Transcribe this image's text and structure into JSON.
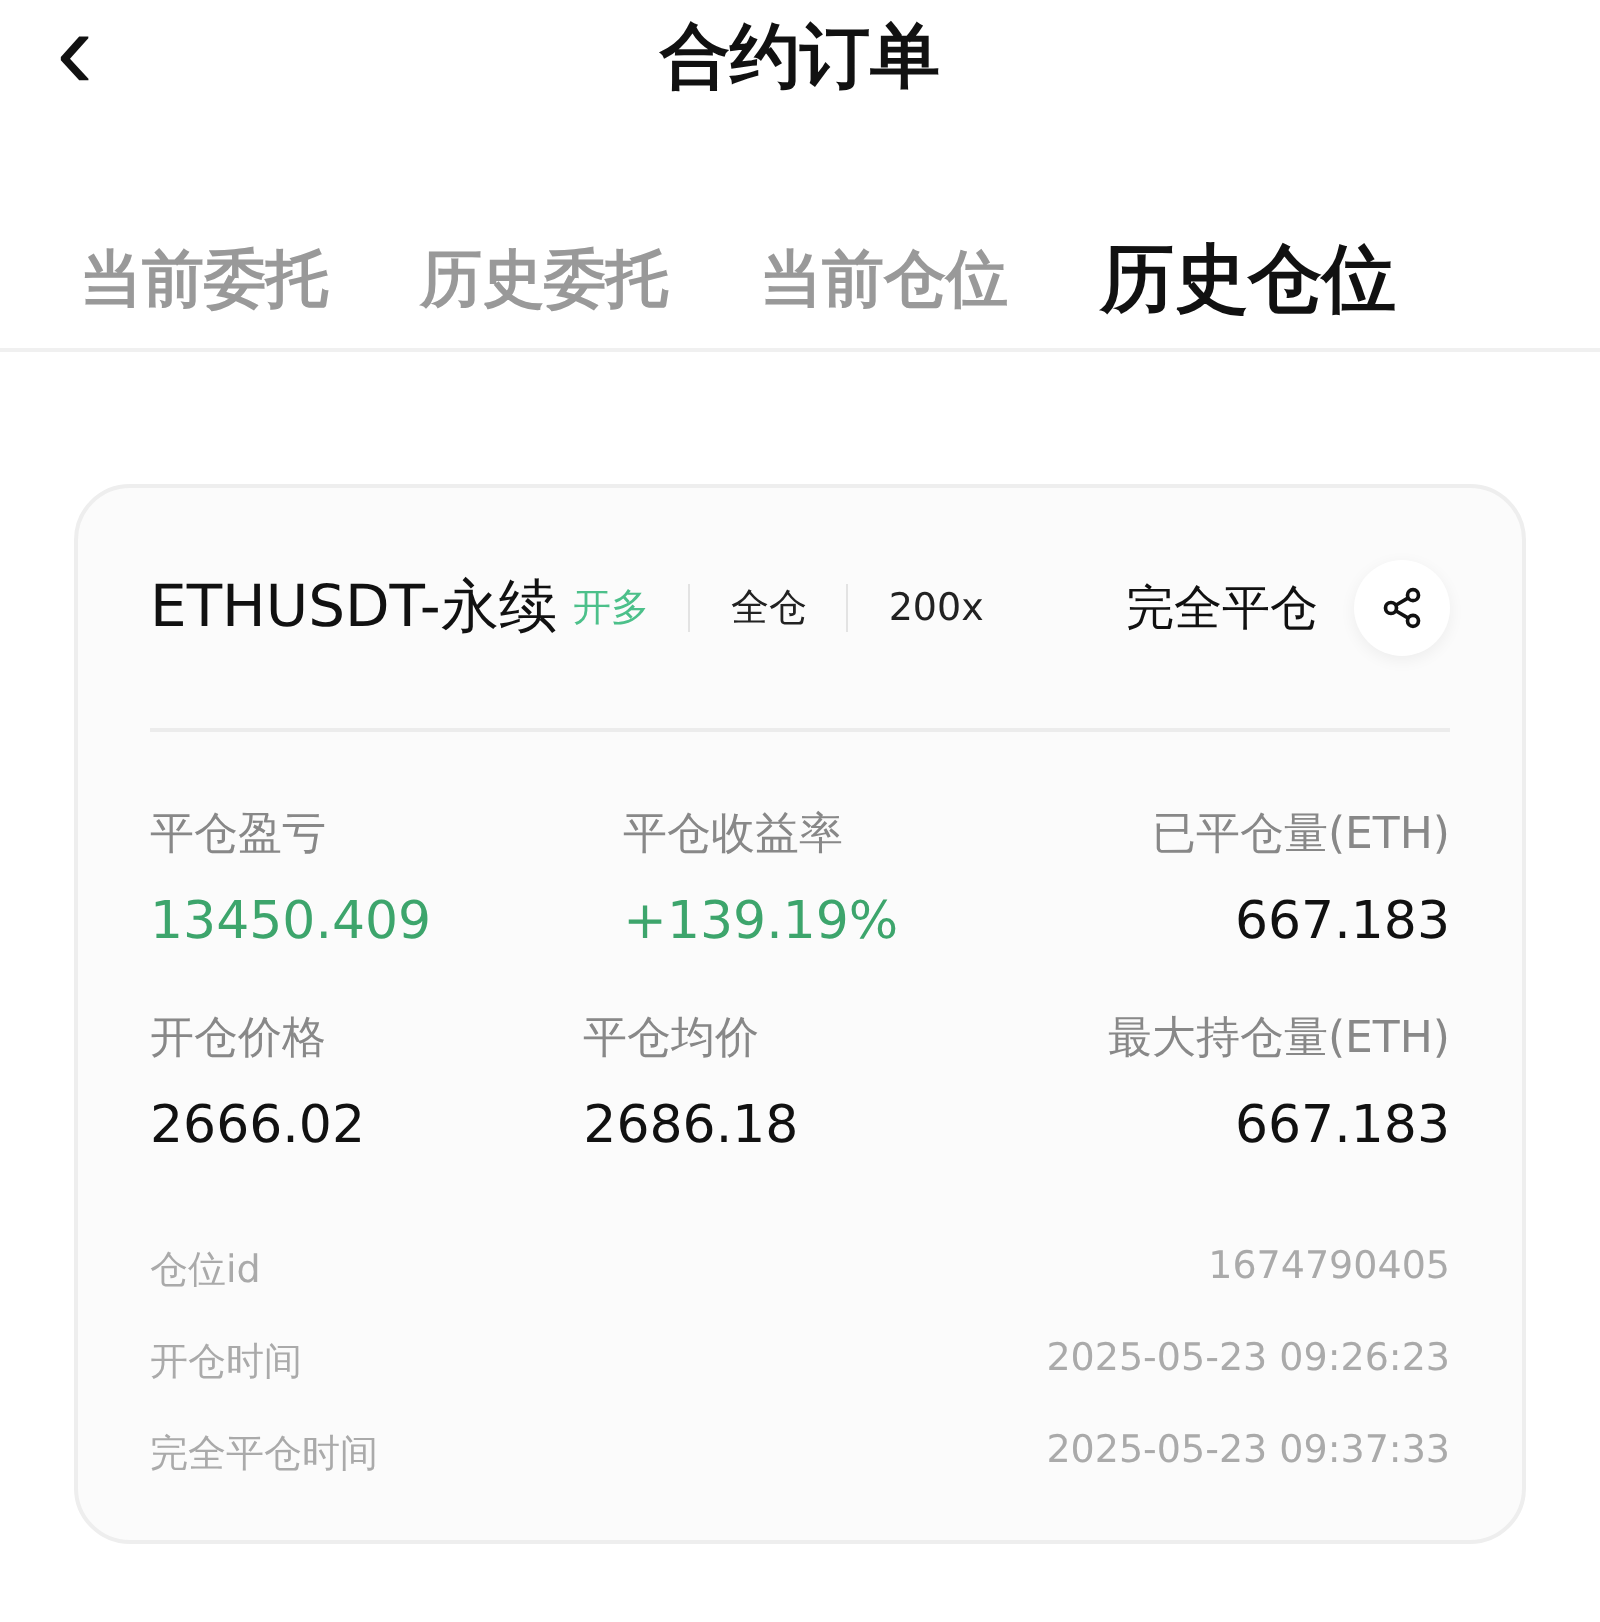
{
  "header": {
    "back_icon": "‹",
    "title": "合约订单"
  },
  "tabs": [
    {
      "label": "当前委托",
      "selected": false
    },
    {
      "label": "历史委托",
      "selected": false
    },
    {
      "label": "当前仓位",
      "selected": false
    },
    {
      "label": "历史仓位",
      "selected": true
    }
  ],
  "position": {
    "symbol": "ETHUSDT-永续",
    "side": "开多",
    "margin_mode": "全仓",
    "leverage": "200x",
    "status": "完全平仓",
    "stats": [
      [
        {
          "label": "平仓盈亏",
          "value": "13450.409",
          "color": "#3da56c"
        },
        {
          "label": "平仓收益率",
          "value": "+139.19%",
          "color": "#3da56c"
        },
        {
          "label": "已平仓量(ETH)",
          "value": "667.183",
          "color": "#111111"
        }
      ],
      [
        {
          "label": "开仓价格",
          "value": "2666.02",
          "color": "#111111"
        },
        {
          "label": "平仓均价",
          "value": "2686.18",
          "color": "#111111"
        },
        {
          "label": "最大持仓量(ETH)",
          "value": "667.183",
          "color": "#111111"
        }
      ]
    ],
    "details": [
      {
        "label": "仓位id",
        "value": "1674790405"
      },
      {
        "label": "开仓时间",
        "value": "2025-05-23 09:26:23"
      },
      {
        "label": "完全平仓时间",
        "value": "2025-05-23 09:37:33"
      }
    ]
  }
}
